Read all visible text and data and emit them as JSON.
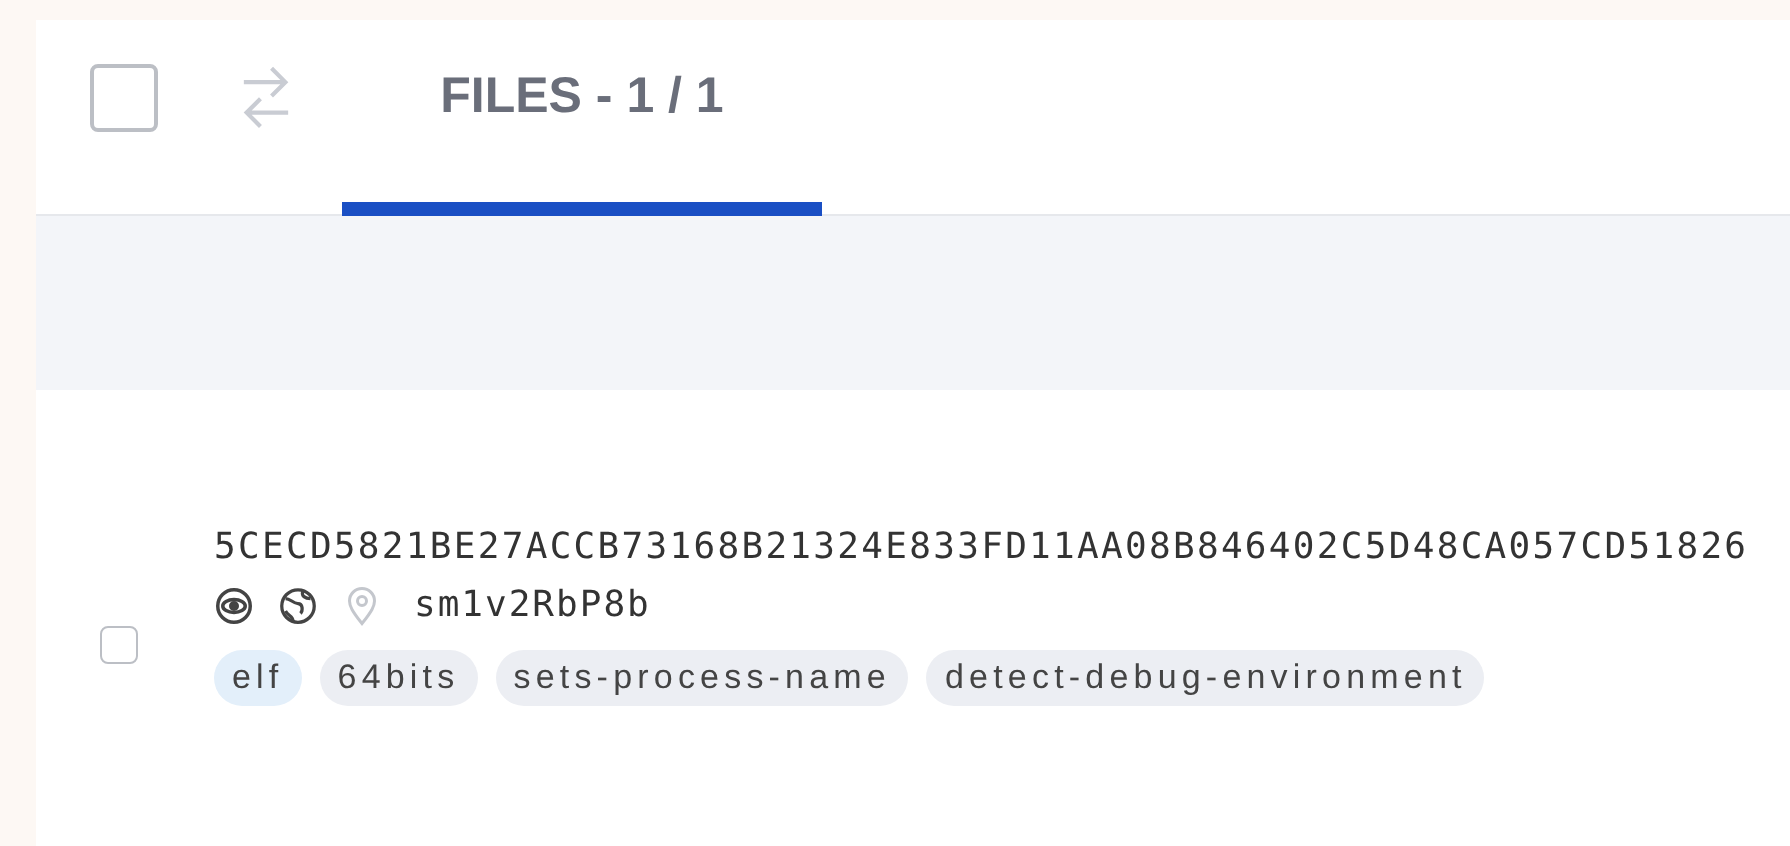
{
  "header": {
    "select_all": {
      "checked": false
    },
    "tabs": [
      {
        "label": "FILES - 1 / 1",
        "selected": true
      }
    ]
  },
  "files": [
    {
      "checked": false,
      "hash": "5CECD5821BE27ACCB73168B21324E833FD11AA08B846402C5D48CA057CD51826",
      "name": "sm1v2RbP8b",
      "tags": [
        {
          "label": "elf",
          "color": "#e3effa"
        },
        {
          "label": "64bits",
          "color": "#eceef3"
        },
        {
          "label": "sets-process-name",
          "color": "#eceef3"
        },
        {
          "label": "detect-debug-environment",
          "color": "#eceef3"
        }
      ]
    }
  ]
}
